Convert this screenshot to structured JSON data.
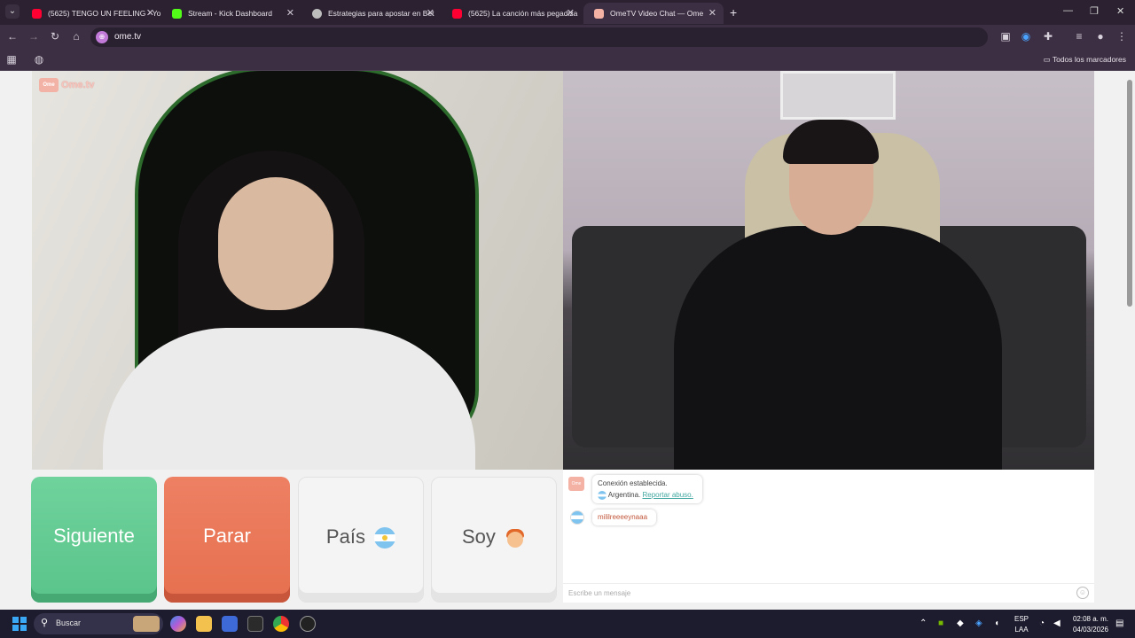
{
  "browser": {
    "tabs": [
      {
        "title": "(5625) TENGO UN FEELING - Yo",
        "favicon_color": "#ff0033"
      },
      {
        "title": "Stream - Kick Dashboard",
        "favicon_color": "#53fc18"
      },
      {
        "title": "Estrategias para apostar en Bet",
        "favicon_color": "#bdbdbd"
      },
      {
        "title": "(5625) La canción más pegadiza",
        "favicon_color": "#ff0033"
      },
      {
        "title": "OmeTV Video Chat — Ome",
        "favicon_color": "#f4b2a5"
      }
    ],
    "url": "ome.tv",
    "bookmarks_label": "Todos los marcadores"
  },
  "page": {
    "logo_text": "Ome.tv",
    "buttons": {
      "next": "Siguiente",
      "stop": "Parar",
      "country": "País",
      "gender": "Soy"
    },
    "chat": {
      "system_message": "Conexión establecida.",
      "country": "Argentina.",
      "report_link": "Reportar abuso.",
      "messages": [
        {
          "text": "mililreeeeynaaa"
        }
      ],
      "input_placeholder": "Escribe un mensaje"
    }
  },
  "taskbar": {
    "search_label": "Buscar",
    "language": "ESP",
    "layout": "LAA",
    "time": "02:08 a. m.",
    "date": "04/03/2026"
  },
  "colors": {
    "next_button": "#5fc891",
    "stop_button": "#e8755a",
    "report_link": "#41a7a0",
    "message_text": "#c2573b"
  }
}
